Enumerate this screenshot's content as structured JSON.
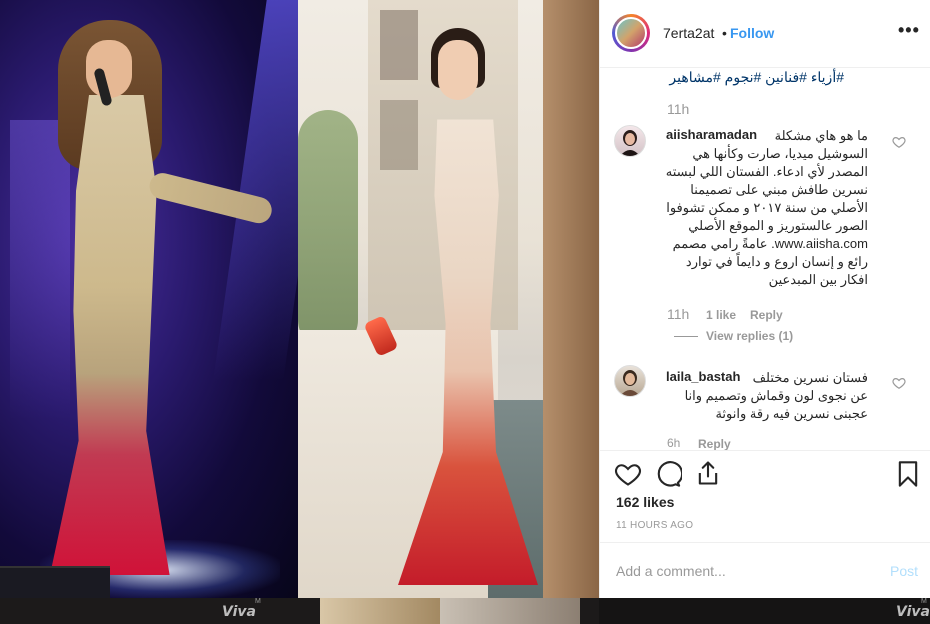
{
  "post": {
    "username": "7erta2at",
    "separator": "•",
    "follow_label": "Follow",
    "more_label": "•••",
    "caption_tags": "#أزياء #فنانين #نجوم #مشاهير",
    "caption_time": "11h",
    "likes": "162 likes",
    "posted": "11 HOURS AGO",
    "add_comment_placeholder": "Add a comment...",
    "post_label": "Post"
  },
  "comments": [
    {
      "username": "aiisharamadan",
      "text": "ما هو هاي مشكلة السوشيل ميديا، صارت وكأنها هي المصدر لأي ادعاء. الفستان اللي لبسته نسرين طافش مبني على تصميمنا الأصلي من سنة ٢٠١٧ و ممكن تشوفوا الصور عالستوريز و الموقع الأصلي www.aiisha.com. عامةً رامي مصمم رائع و إنسان اروع و دايماً في توارد افكار بين المبدعين",
      "time": "11h",
      "likes": "1 like",
      "reply": "Reply",
      "view_replies": "View replies (1)"
    },
    {
      "username": "laila_bastah",
      "text": "فستان نسرين مختلف عن نجوى لون وقماش وتصميم وانا عجبنى نسرين فيه رقة وانوثة",
      "time": "6h",
      "reply": "Reply"
    }
  ],
  "watermark": {
    "main": "Viva",
    "small": "M"
  },
  "colors": {
    "link_blue": "#3897f0",
    "hashtag_navy": "#003569",
    "muted": "#999999",
    "post_disabled": "#b2dffc"
  },
  "icons": [
    "heart-icon",
    "comment-icon",
    "share-icon",
    "bookmark-icon",
    "more-options-icon"
  ]
}
